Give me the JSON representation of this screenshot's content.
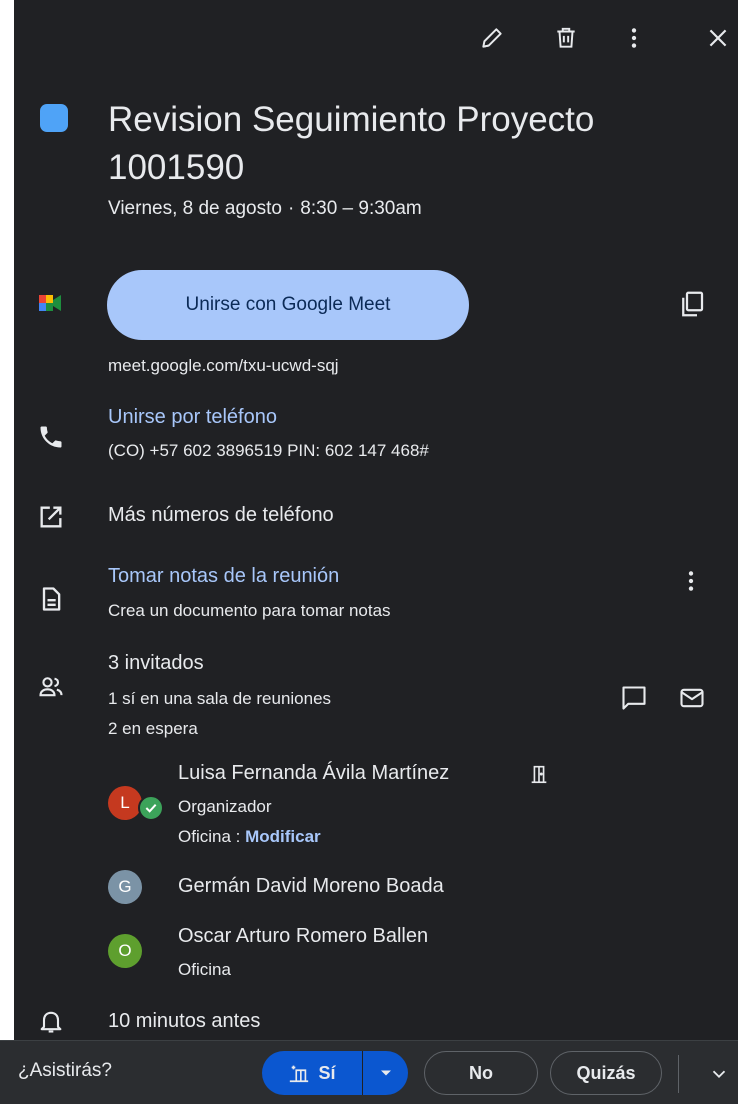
{
  "event": {
    "title": "Revision Seguimiento Proyecto 1001590",
    "date": "Viernes, 8 de agosto",
    "separator": "·",
    "time": "8:30 – 9:30am",
    "color": "#4fa3f7"
  },
  "toolbar": {
    "edit_icon": "pencil-icon",
    "delete_icon": "trash-icon",
    "more_icon": "more-vert-icon",
    "close_icon": "close-icon"
  },
  "meet": {
    "button_label": "Unirse con Google Meet",
    "link": "meet.google.com/txu-ucwd-sqj",
    "copy_icon": "copy-icon"
  },
  "phone": {
    "label": "Unirse por teléfono",
    "details": "(CO) +57 602 3896519 PIN: 602 147 468#"
  },
  "more_numbers": {
    "label": "Más números de teléfono"
  },
  "notes": {
    "label": "Tomar notas de la reunión",
    "description": "Crea un documento para tomar notas"
  },
  "guests": {
    "count_label": "3 invitados",
    "status_yes": "1 sí en una sala de reuniones",
    "status_waiting": "2 en espera",
    "list": [
      {
        "initial": "L",
        "name": "Luisa Fernanda Ávila Martínez",
        "role": "Organizador",
        "location": "Oficina",
        "location_sep": " : ",
        "modify_label": "Modificar",
        "avatar_color": "#c5391f"
      },
      {
        "initial": "G",
        "name": "Germán David Moreno Boada",
        "avatar_color": "#7b93a6"
      },
      {
        "initial": "O",
        "name": "Oscar Arturo Romero Ballen",
        "location": "Oficina",
        "avatar_color": "#5e9f2e"
      }
    ]
  },
  "reminder": {
    "label": "10 minutos antes"
  },
  "rsvp": {
    "question": "¿Asistirás?",
    "yes_label": "Sí",
    "no_label": "No",
    "maybe_label": "Quizás"
  }
}
